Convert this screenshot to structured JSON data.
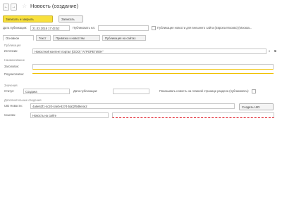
{
  "window": {
    "title": "Новость (создание)",
    "star": "☆",
    "back": "←",
    "forward": "→"
  },
  "toolbar": {
    "save_close": "Записать и закрыть",
    "save": "Записать"
  },
  "header": {
    "date_label": "Дата публикации:",
    "date_value": "21.03.2018 17:43:52",
    "schedule_label": "Публиковать на:",
    "schedule_value": "",
    "checkbox_label": "Публикация новости для внешнего сайта (Европа Москва) (Москва...",
    "save_icon": "save-icon"
  },
  "tabs": [
    {
      "label": "Основное"
    },
    {
      "label": "Текст"
    },
    {
      "label": "Привязка к новостям"
    },
    {
      "label": "Публикация на сайтах"
    }
  ],
  "publication": {
    "section": "Публикация",
    "source_label": "Источник:",
    "source_value": "Новостной контент портал (ООО) \"АГРОРЕГИОН\""
  },
  "title_block": {
    "section": "Наименование",
    "title_label": "Заголовок:",
    "title_value": "",
    "subtitle_label": "Подзаголовок:"
  },
  "status": {
    "section": "Значения",
    "status_label": "Статус:",
    "status_value": "Создана",
    "publish_label": "Дата публикации:",
    "publish_value": "",
    "flag_label": "Показывать новость на главной странице раздела (публиковать):"
  },
  "extra": {
    "section": "Дополнительные сведения",
    "uid_label": "UID Новости:",
    "uid_value": "4a9e63f1-4c20-44eb-8274-bdd2f9d9e4e2",
    "new_uid_button": "Создать UID",
    "link_label": "Ссылка:",
    "link_value": "Новость на сайте"
  }
}
